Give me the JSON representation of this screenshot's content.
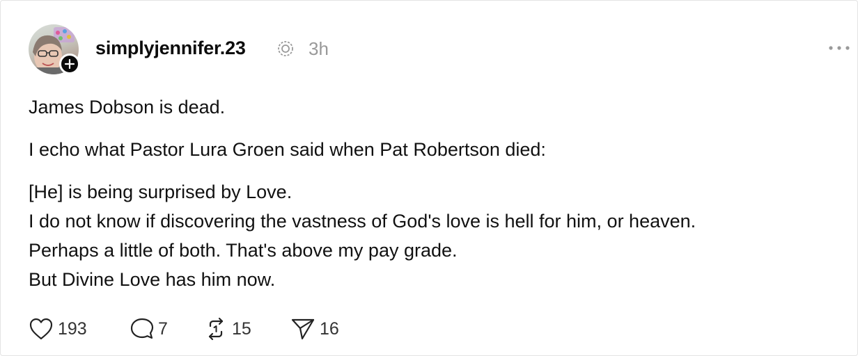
{
  "post": {
    "username": "simplyjennifer.23",
    "time": "3h",
    "lines": [
      "James Dobson is dead.",
      "I echo what Pastor Lura Groen said when Pat Robertson died:",
      "[He] is being surprised by Love.",
      "I do not know if discovering the vastness of God's love is hell for him, or heaven.",
      "Perhaps a little of both. That's above my pay grade.",
      "But Divine Love has him now."
    ]
  },
  "actions": {
    "likes": "193",
    "comments": "7",
    "reposts": "15",
    "shares": "16"
  },
  "icons": {
    "verified": "threads-badge-icon",
    "more": "more-options-icon",
    "like": "heart-icon",
    "comment": "comment-bubble-icon",
    "repost": "repost-icon",
    "share": "send-icon",
    "follow": "plus-icon"
  }
}
